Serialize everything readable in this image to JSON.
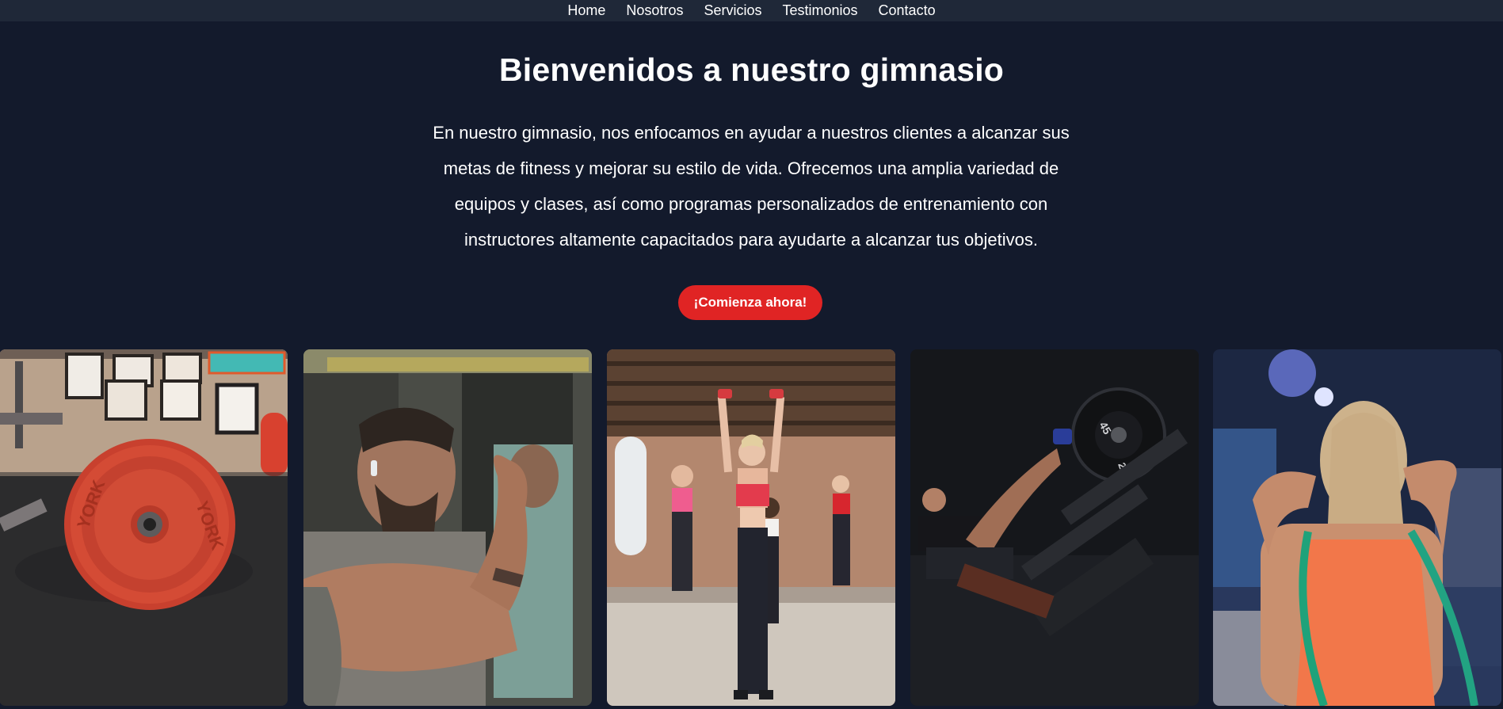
{
  "nav": {
    "items": [
      {
        "label": "Home"
      },
      {
        "label": "Nosotros"
      },
      {
        "label": "Servicios"
      },
      {
        "label": "Testimonios"
      },
      {
        "label": "Contacto"
      }
    ]
  },
  "hero": {
    "title": "Bienvenidos a nuestro gimnasio",
    "description": "En nuestro gimnasio, nos enfocamos en ayudar a nuestros clientes a alcanzar sus metas de fitness y mejorar su estilo de vida. Ofrecemos una amplia variedad de equipos y clases, así como programas personalizados de entrenamiento con instructores altamente capacitados para ayudarte a alcanzar tus objetivos.",
    "cta_label": "¡Comienza ahora!"
  },
  "gallery": {
    "plate_text_left": "YORK",
    "plate_text_right": "YORK",
    "leg_press_plate_45": "45",
    "leg_press_plate_weight": "20.4"
  },
  "colors": {
    "background": "#131a2c",
    "nav_background": "#1f2838",
    "accent": "#e02424",
    "text": "#ffffff"
  }
}
